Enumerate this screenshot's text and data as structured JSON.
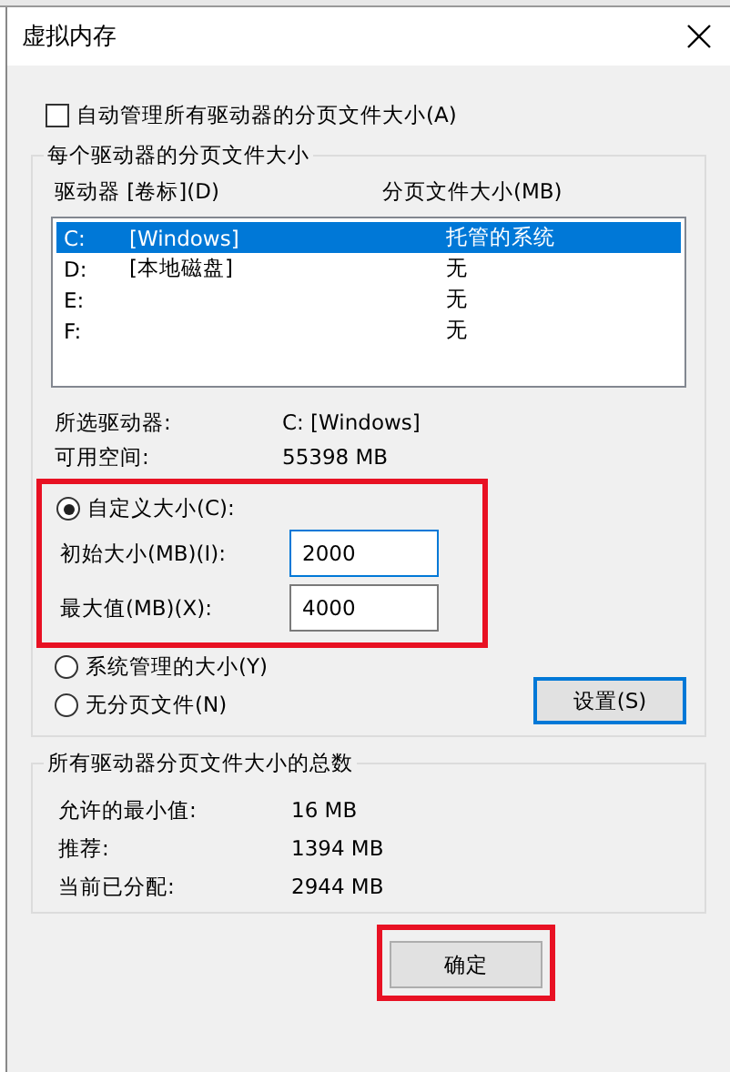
{
  "window": {
    "title": "虚拟内存"
  },
  "auto_manage": {
    "label": "自动管理所有驱动器的分页文件大小(A)",
    "checked": false
  },
  "drives_group": {
    "title": "每个驱动器的分页文件大小",
    "columns": [
      "驱动器 [卷标](D)",
      "分页文件大小(MB)"
    ],
    "rows": [
      {
        "drive": "C:",
        "label": "[Windows]",
        "size": "托管的系统",
        "selected": true
      },
      {
        "drive": "D:",
        "label": "[本地磁盘]",
        "size": "无",
        "selected": false
      },
      {
        "drive": "E:",
        "label": "",
        "size": "无",
        "selected": false
      },
      {
        "drive": "F:",
        "label": "",
        "size": "无",
        "selected": false
      }
    ],
    "info": [
      {
        "label": "所选驱动器:",
        "value": "C:  [Windows]"
      },
      {
        "label": "可用空间:",
        "value": "55398 MB"
      }
    ],
    "size_options": [
      {
        "kind": "custom",
        "label": "自定义大小(C):",
        "selected": true,
        "highlighted": true,
        "fields": [
          {
            "label": "初始大小(MB)(I):",
            "value": "2000",
            "focused": true
          },
          {
            "label": "最大值(MB)(X):",
            "value": "4000",
            "focused": false
          }
        ]
      },
      {
        "kind": "plain",
        "label": "系统管理的大小(Y)",
        "selected": false,
        "highlighted": false
      },
      {
        "kind": "plain",
        "label": "无分页文件(N)",
        "selected": false,
        "highlighted": false
      }
    ],
    "set_button": {
      "label": "设置(S)",
      "focused": true
    }
  },
  "totals_group": {
    "title": "所有驱动器分页文件大小的总数",
    "rows": [
      {
        "label": "允许的最小值:",
        "value": "16 MB"
      },
      {
        "label": "推荐:",
        "value": "1394 MB"
      },
      {
        "label": "当前已分配:",
        "value": "2944 MB"
      }
    ]
  },
  "ok_button": {
    "label": "确定",
    "highlighted": true
  }
}
